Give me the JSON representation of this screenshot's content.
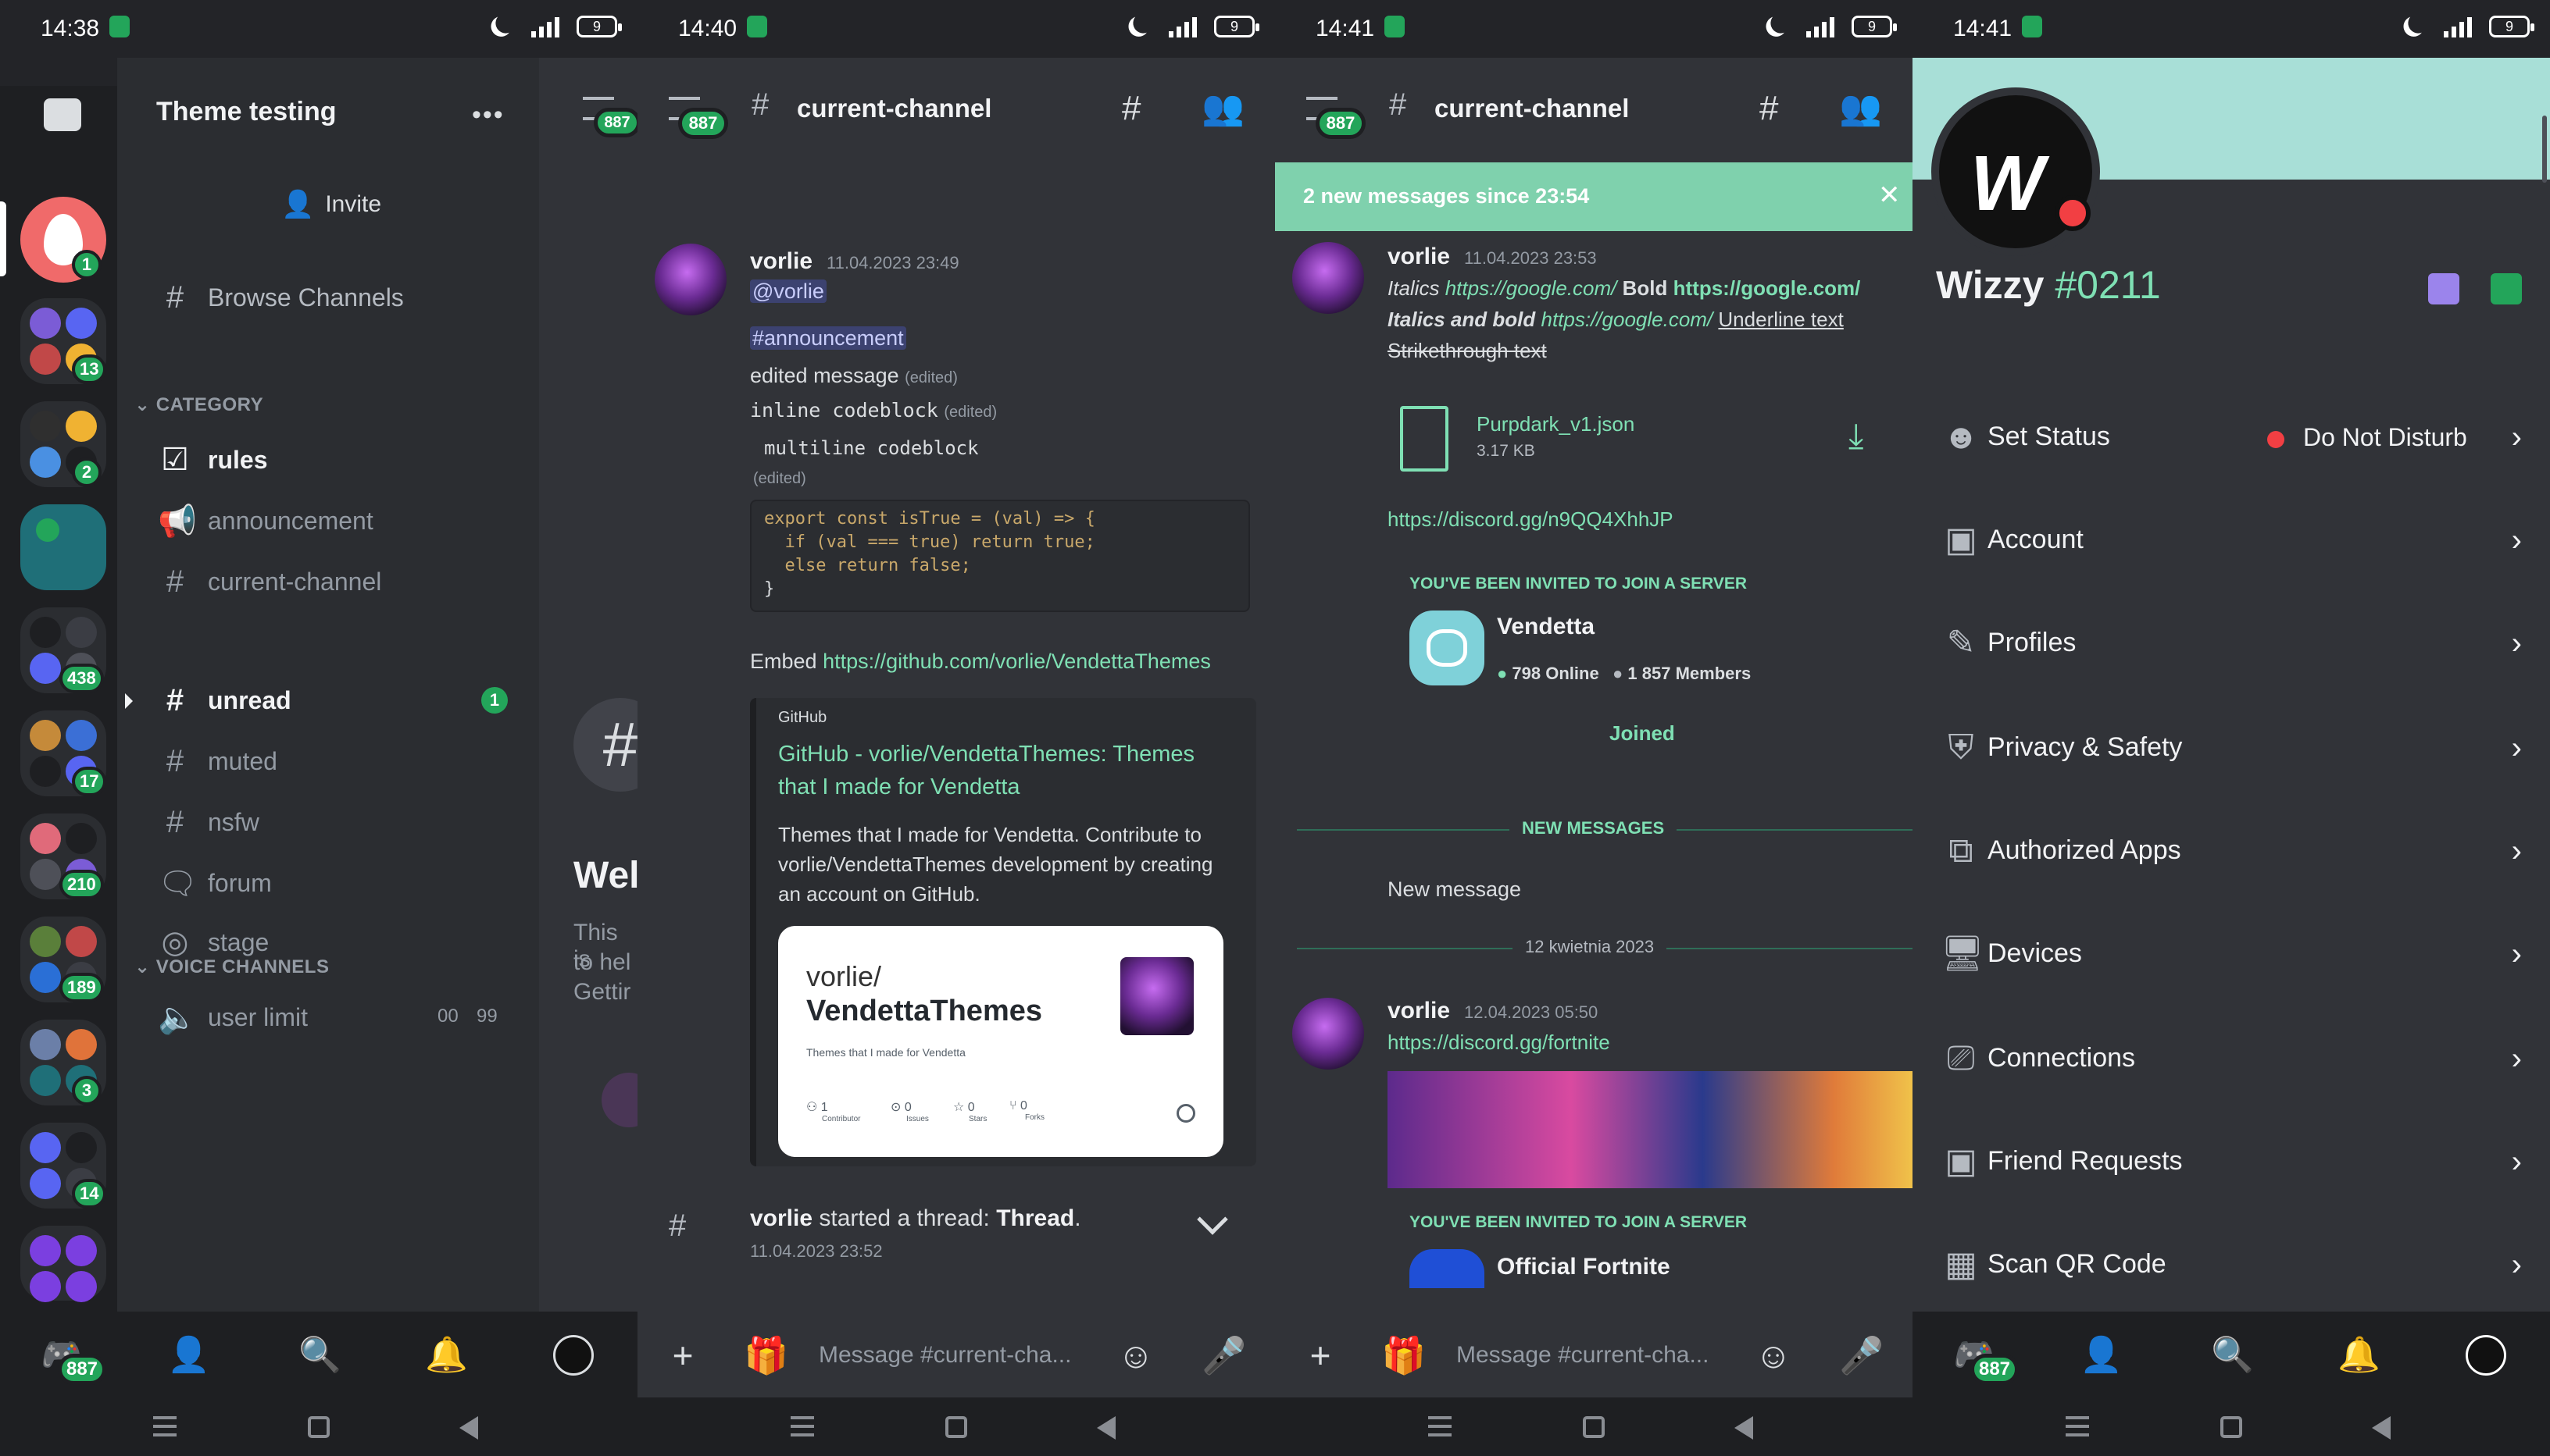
{
  "status_bars": [
    {
      "time": "14:38",
      "battery": "9"
    },
    {
      "time": "14:40",
      "battery": "9"
    },
    {
      "time": "14:41",
      "battery": "9"
    },
    {
      "time": "14:41",
      "battery": "9"
    }
  ],
  "colors": {
    "accent": "#23a55a",
    "mint": "#7fe0b4",
    "banner": "#a8dfd7",
    "bg": "#313338",
    "sidebar": "#2b2d31",
    "rail": "#1e1f22"
  },
  "screen1": {
    "server_name": "Theme testing",
    "more_icon": "more-dots-icon",
    "peek_badge": "887",
    "invite_label": "Invite",
    "browse_channels": "Browse Channels",
    "category_label": "CATEGORY",
    "channels": [
      {
        "name": "rules",
        "icon": "rules-icon",
        "bright": true
      },
      {
        "name": "announcement",
        "icon": "megaphone-icon",
        "bright": false
      },
      {
        "name": "current-channel",
        "icon": "thread-hash-icon",
        "bright": false
      },
      {
        "name": "unread",
        "icon": "hash-icon",
        "bright": true,
        "badge": "1"
      },
      {
        "name": "muted",
        "icon": "hash-icon",
        "bright": false
      },
      {
        "name": "nsfw",
        "icon": "nsfw-hash-icon",
        "bright": false
      },
      {
        "name": "forum",
        "icon": "forum-icon",
        "bright": false
      },
      {
        "name": "stage",
        "icon": "stage-icon",
        "bright": false
      }
    ],
    "voice_category_label": "VOICE CHANNELS",
    "voice_channel": {
      "name": "user limit",
      "count": "00",
      "limit": "99"
    },
    "server_badges": [
      "1",
      "13",
      "2",
      "",
      "438",
      "17",
      "210",
      "189",
      "3",
      "14",
      ""
    ],
    "peek_text": {
      "heading": "Wel",
      "line1": "This is",
      "line2": "to hel",
      "line3": "Gettir"
    },
    "home_badge": "887"
  },
  "screen2": {
    "badge": "887",
    "channel": "current-channel",
    "message": {
      "author": "vorlie",
      "timestamp": "11.04.2023 23:49",
      "mention": "@vorlie",
      "channel_mention": "#announcement",
      "edited_text": "edited message",
      "edited_tag": "(edited)",
      "inline_code": "inline codeblock",
      "multiline_code": "multiline codeblock",
      "code_lines": [
        "export const isTrue = (val) => {",
        "  if (val === true) return true;",
        "  else return false;",
        "}"
      ],
      "embed_prefix": "Embed",
      "embed_link": "https://github.com/vorlie/VendettaThemes"
    },
    "embed": {
      "provider": "GitHub",
      "title_line1": "GitHub - vorlie/VendettaThemes: Themes",
      "title_line2": "that I made for Vendetta",
      "desc_line1": "Themes that I made for Vendetta. Contribute to",
      "desc_line2": "vorlie/VendettaThemes development by creating",
      "desc_line3": "an account on GitHub.",
      "card_owner": "vorlie/",
      "card_repo": "VendettaThemes",
      "card_sub": "Themes that I made for Vendetta",
      "stats": [
        {
          "value": "1",
          "label": "Contributor"
        },
        {
          "value": "0",
          "label": "Issues"
        },
        {
          "value": "0",
          "label": "Stars"
        },
        {
          "value": "0",
          "label": "Forks"
        }
      ]
    },
    "thread": {
      "author": "vorlie",
      "action": "started a thread:",
      "name": "Thread",
      "punct": ".",
      "timestamp": "11.04.2023 23:52"
    },
    "composer_placeholder": "Message #current-cha..."
  },
  "screen3": {
    "badge": "887",
    "channel": "current-channel",
    "new_banner": "2 new messages since 23:54",
    "message1": {
      "author": "vorlie",
      "timestamp": "11.04.2023 23:53",
      "italics": "Italics",
      "link1": "https://google.com/",
      "bold": "Bold",
      "link2": "https://google.com/",
      "italics_bold": "Italics and bold",
      "link3": "https://google.com/",
      "underline": "Underline text",
      "strike": "Strikethrough text"
    },
    "file": {
      "name": "Purpdark_v1.json",
      "size": "3.17 KB"
    },
    "invite_link": "https://discord.gg/n9QQ4XhhJP",
    "invite1": {
      "header": "YOU'VE BEEN INVITED TO JOIN A SERVER",
      "server": "Vendetta",
      "online": "798 Online",
      "members": "1 857 Members",
      "button": "Joined"
    },
    "new_messages_divider": "NEW MESSAGES",
    "new_message": "New message",
    "date_divider": "12 kwietnia 2023",
    "message2": {
      "author": "vorlie",
      "timestamp": "12.04.2023 05:50",
      "link": "https://discord.gg/fortnite"
    },
    "invite2": {
      "header": "YOU'VE BEEN INVITED TO JOIN A SERVER",
      "server": "Official Fortnite"
    },
    "composer_placeholder": "Message #current-cha..."
  },
  "screen4": {
    "display_name": "Wizzy",
    "discriminator": "#0211",
    "status_value": "Do Not Disturb",
    "menu": [
      {
        "label": "Set Status",
        "icon": "status-icon"
      },
      {
        "label": "Account",
        "icon": "account-icon"
      },
      {
        "label": "Profiles",
        "icon": "pencil-icon"
      },
      {
        "label": "Privacy & Safety",
        "icon": "shield-icon"
      },
      {
        "label": "Authorized Apps",
        "icon": "apps-icon"
      },
      {
        "label": "Devices",
        "icon": "monitor-icon"
      },
      {
        "label": "Connections",
        "icon": "connections-icon"
      },
      {
        "label": "Friend Requests",
        "icon": "friend-request-icon"
      },
      {
        "label": "Scan QR Code",
        "icon": "qr-icon"
      }
    ],
    "home_badge": "887"
  }
}
